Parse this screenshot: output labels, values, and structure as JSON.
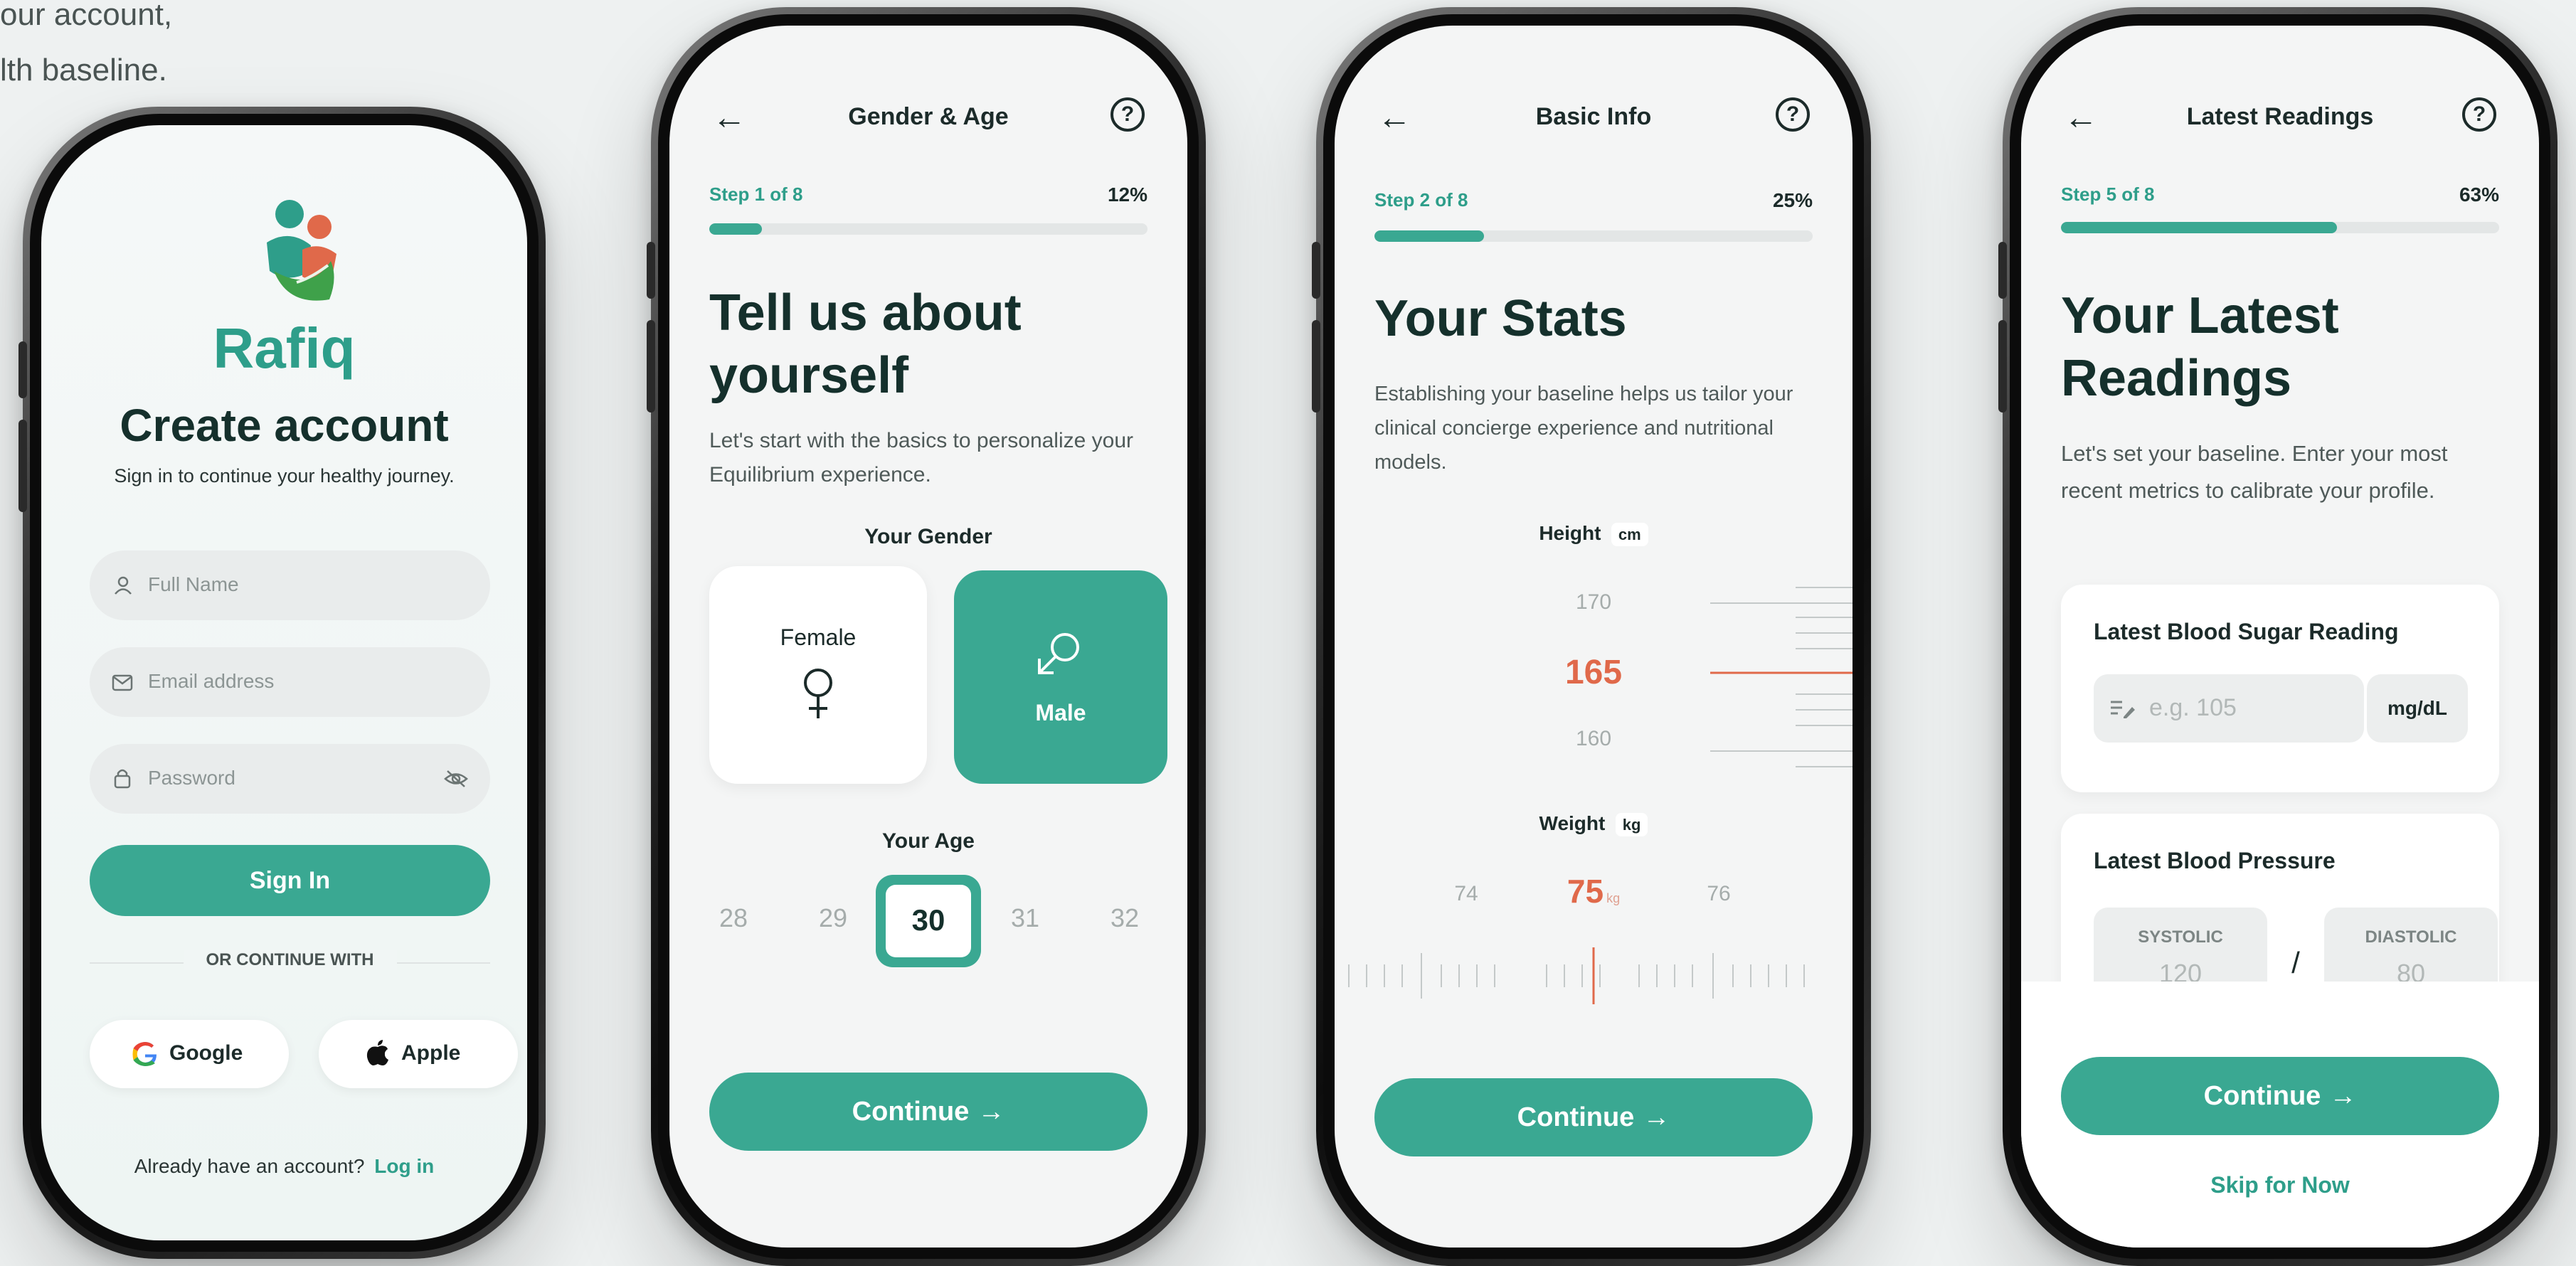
{
  "intro": {
    "line1": "our account,",
    "line2": "lth baseline."
  },
  "screen1": {
    "brand": "Rafiq",
    "title": "Create account",
    "subtitle": "Sign in to continue your healthy journey.",
    "fullname_placeholder": "Full Name",
    "email_placeholder": "Email address",
    "password_placeholder": "Password",
    "signin_label": "Sign In",
    "divider_label": "OR CONTINUE WITH",
    "google_label": "Google",
    "apple_label": "Apple",
    "login_prompt": "Already have an account?",
    "login_link": "Log in"
  },
  "screen2": {
    "header_title": "Gender & Age",
    "step_label": "Step 1 of 8",
    "percent": "12%",
    "progress": 0.12,
    "heading": "Tell us about yourself",
    "description": "Let's start with the basics to personalize your Equilibrium experience.",
    "gender_label": "Your Gender",
    "gender_female": "Female",
    "gender_male": "Male",
    "selected_gender": "Male",
    "age_label": "Your Age",
    "ages": [
      "28",
      "29",
      "30",
      "31",
      "32"
    ],
    "selected_age": "30",
    "continue_label": "Continue"
  },
  "screen3": {
    "header_title": "Basic Info",
    "step_label": "Step 2 of 8",
    "percent": "25%",
    "progress": 0.25,
    "heading": "Your Stats",
    "description": "Establishing your baseline helps us tailor your clinical concierge experience and nutritional models.",
    "height_label": "Height",
    "height_unit": "cm",
    "height_above": "170",
    "height_value": "165",
    "height_below": "160",
    "weight_label": "Weight",
    "weight_unit": "kg",
    "weight_left": "74",
    "weight_value": "75",
    "weight_value_unit": "kg",
    "weight_right": "76",
    "continue_label": "Continue"
  },
  "screen4": {
    "header_title": "Latest Readings",
    "step_label": "Step 5 of 8",
    "percent": "63%",
    "progress": 0.63,
    "heading": "Your Latest Readings",
    "description": "Let's set your baseline. Enter your most recent metrics to calibrate your profile.",
    "sugar_label": "Latest Blood Sugar Reading",
    "sugar_placeholder": "e.g. 105",
    "sugar_unit": "mg/dL",
    "bp_label": "Latest Blood Pressure",
    "systolic_label": "SYSTOLIC",
    "systolic_value": "120",
    "bp_separator": "/",
    "diastolic_label": "DIASTOLIC",
    "diastolic_value": "80",
    "continue_label": "Continue",
    "skip_label": "Skip for Now"
  },
  "colors": {
    "accent": "#3aa892",
    "highlight": "#e0694a",
    "text": "#1c2b2a"
  }
}
